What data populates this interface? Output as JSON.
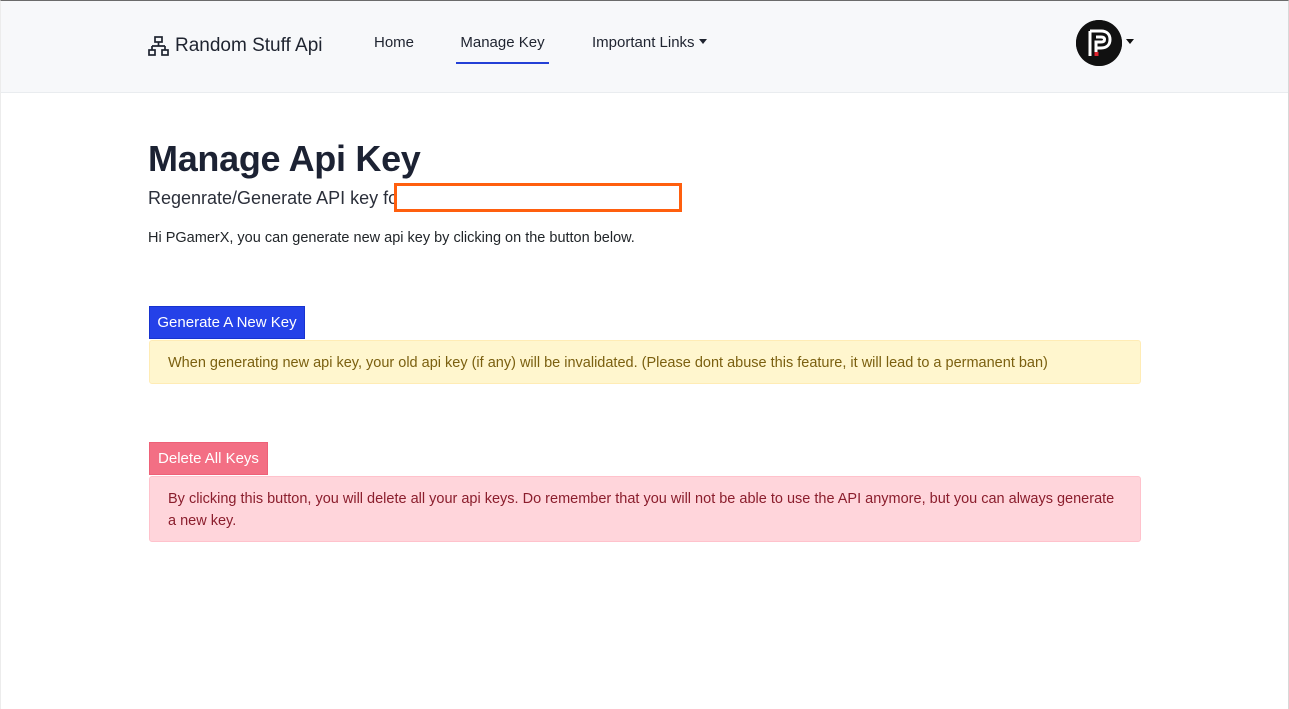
{
  "navbar": {
    "brand": "Random Stuff Api",
    "brand_icon": "sitemap-icon",
    "links": {
      "home": "Home",
      "manage_key": "Manage Key",
      "important_links": "Important Links"
    },
    "active_link": "Manage Key",
    "avatar_icon": "pgamerx-logo-icon",
    "accent_color": "#2440d6"
  },
  "main": {
    "title": "Manage Api Key",
    "subtitle": "Regenrate/Generate API key for",
    "intro": "Hi PGamerX, you can generate new api key by clicking on the button below.",
    "generate_button": "Generate A New Key",
    "generate_warning": "When generating new api key, your old api key (if any) will be invalidated. (Please dont abuse this feature, it will lead to a permanent ban)",
    "delete_button": "Delete All Keys",
    "delete_warning": "By clicking this button, you will delete all your api keys. Do remember that you will not be able to use the API anymore, but you can always generate a new key."
  },
  "colors": {
    "primary": "#2441e8",
    "danger": "#f36f84",
    "redaction": "#ff5f0e"
  }
}
